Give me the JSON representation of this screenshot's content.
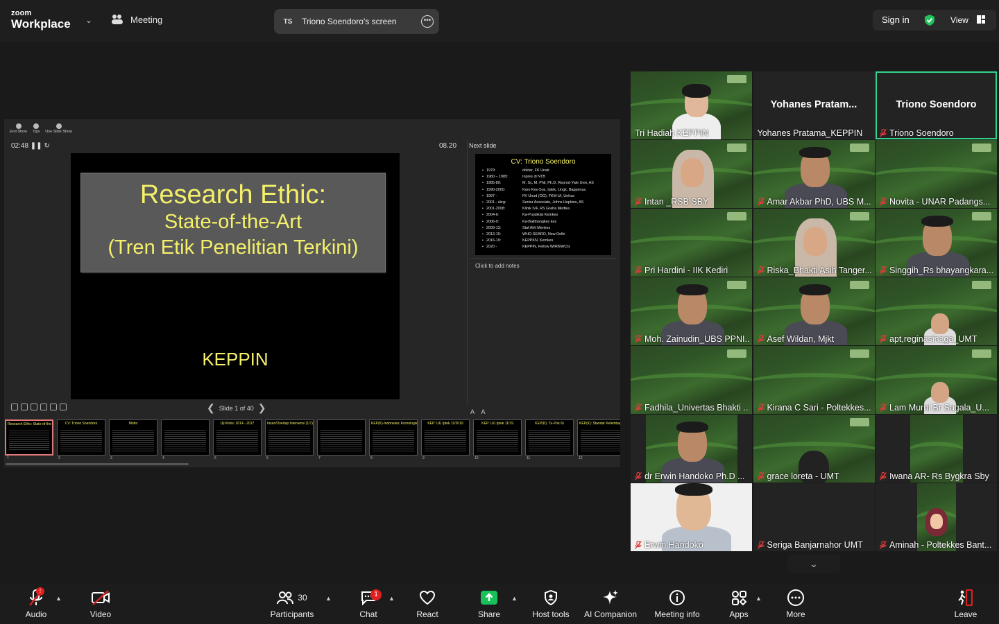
{
  "app": {
    "brand_small": "zoom",
    "brand_big": "Workplace",
    "meeting_label": "Meeting",
    "share_pill": {
      "initials": "TS",
      "label": "Triono Soendoro's screen"
    },
    "sign_in": "Sign in",
    "view": "View",
    "accent": "#32d38b"
  },
  "presenter": {
    "tools": [
      "End Show",
      "Tips",
      "Use Slide Show"
    ],
    "timer": "02:48",
    "clock": "08.20",
    "next_label": "Next slide",
    "notes_placeholder": "Click to add notes",
    "slide_counter": "Slide 1 of 40",
    "current_slide": {
      "title": "Research Ethic:",
      "line2": "State-of-the-Art",
      "line3": "(Tren Etik Penelitian Terkini)",
      "footer": "KEPPIN"
    },
    "next_slide": {
      "title": "CV: Triono Soendoro",
      "rows": [
        {
          "year": "1979:",
          "desc": "dokter, FK Unair"
        },
        {
          "year": "1980 – 1985:",
          "desc": "Inpres di NTB"
        },
        {
          "year": "1985-89:",
          "desc": "M. Sc, M. Phil, Ph.D, Reprod-Yale Univ, AS"
        },
        {
          "year": "1990-2000:",
          "desc": "Karo Kes-Sos, Iptek, Lingk, Bappenas."
        },
        {
          "year": "1997 -",
          "desc": "FK Unud (OG), FKM-UI, Unhas"
        },
        {
          "year": "2001 - skrg:",
          "desc": "Senior Associate, Johns Hopkins, AS"
        },
        {
          "year": "2001-2008:",
          "desc": "Klinik IVF, RS Graha Medika"
        },
        {
          "year": "2004-6:",
          "desc": "Ka-Pusdiklat Kemkes"
        },
        {
          "year": "2006-9:",
          "desc": "Ka-Balitbangkes kes"
        },
        {
          "year": "2009-13:",
          "desc": "Staf Ahli Menkes"
        },
        {
          "year": "2013-15:",
          "desc": "WHO-SEARO, New Delhi"
        },
        {
          "year": "2016-19:",
          "desc": "KEPPKN, Kemkes"
        },
        {
          "year": "2020 -",
          "desc": "KEPPIN, Fellow WIRB/WCG"
        }
      ]
    },
    "thumbnails": [
      {
        "n": "1",
        "title": "Research Ethic: State-of-the-Art (Tren Etik Penelitian Terkini)"
      },
      {
        "n": "2",
        "title": "CV: Triono Soendoro"
      },
      {
        "n": "3",
        "title": "Motto"
      },
      {
        "n": "4",
        "title": ""
      },
      {
        "n": "5",
        "title": "Uji Klinis: 2014 - 2017"
      },
      {
        "n": "6",
        "title": "Irisan/Overlap Intervensi (1/7)"
      },
      {
        "n": "7",
        "title": ""
      },
      {
        "n": "8",
        "title": "KEP(K)-Indonesia: Kronologis"
      },
      {
        "n": "9",
        "title": "KEP: UU Iptek 11/2019"
      },
      {
        "n": "10",
        "title": "KEP: UU Iptek 11/19"
      },
      {
        "n": "11",
        "title": "KEP(K): Tu-Pok-Si"
      },
      {
        "n": "12",
        "title": "KEP(K): Standar Kelembagaan"
      }
    ]
  },
  "gallery": {
    "tiles": [
      {
        "name": "Tri Hadiah KEPPIN",
        "big": "",
        "muted": false,
        "bg": "kep",
        "person": "woman-glasses"
      },
      {
        "name": "Yohanes Pratama_KEPPIN",
        "big": "Yohanes  Pratam...",
        "muted": false,
        "bg": "dark",
        "person": ""
      },
      {
        "name": "Triono Soendoro",
        "big": "Triono Soendoro",
        "muted": true,
        "bg": "dark",
        "person": "",
        "active": true
      },
      {
        "name": "Intan _RSB SBY",
        "big": "",
        "muted": true,
        "bg": "kep",
        "person": "woman-hijab"
      },
      {
        "name": "Amar Akbar PhD, UBS M...",
        "big": "",
        "muted": true,
        "bg": "kep",
        "person": "man"
      },
      {
        "name": "Novita - UNAR Padangs...",
        "big": "",
        "muted": true,
        "bg": "kep",
        "person": ""
      },
      {
        "name": "Pri Hardini - IIK Kediri",
        "big": "",
        "muted": true,
        "bg": "kep",
        "person": ""
      },
      {
        "name": "Riska_Bhakti Asih Tanger...",
        "big": "",
        "muted": true,
        "bg": "kep",
        "person": "woman-hijab"
      },
      {
        "name": "Singgih_Rs bhayangkara...",
        "big": "",
        "muted": true,
        "bg": "kep",
        "person": "man"
      },
      {
        "name": "Moh. Zainudin_UBS PPNI...",
        "big": "",
        "muted": true,
        "bg": "kep",
        "person": "man"
      },
      {
        "name": "Asef Wildan, Mjkt",
        "big": "",
        "muted": true,
        "bg": "kep",
        "person": "man"
      },
      {
        "name": "apt,reginasinaga_UMT",
        "big": "",
        "muted": true,
        "bg": "kep",
        "person": "woman-small"
      },
      {
        "name": "Fadhila_Univertas Bhakti ...",
        "big": "",
        "muted": true,
        "bg": "kep",
        "person": ""
      },
      {
        "name": "Kirana C Sari - Poltekkes...",
        "big": "",
        "muted": true,
        "bg": "kep",
        "person": ""
      },
      {
        "name": "Lam Murni Br Sagala_U...",
        "big": "",
        "muted": true,
        "bg": "kep",
        "person": "woman-small"
      },
      {
        "name": "dr Erwin Handoko Ph.D ...",
        "big": "",
        "muted": true,
        "bg": "kep-narrow",
        "person": "man-glasses"
      },
      {
        "name": "grace loreta - UMT",
        "big": "",
        "muted": true,
        "bg": "kep",
        "person": "dark-person"
      },
      {
        "name": "Iwana AR- Rs Bygkra Sby",
        "big": "",
        "muted": true,
        "bg": "kep-strip",
        "person": ""
      },
      {
        "name": "Erwin Handoko",
        "big": "",
        "muted": true,
        "bg": "white",
        "person": "man-glasses-big"
      },
      {
        "name": "Seriga Banjarnahor UMT",
        "big": "",
        "muted": true,
        "bg": "dark",
        "person": ""
      },
      {
        "name": "Aminah - Poltekkes Bant...",
        "big": "",
        "muted": true,
        "bg": "kep-strip2",
        "person": "hijab-avatar"
      }
    ]
  },
  "toolbar": {
    "audio": "Audio",
    "audio_badge": "!",
    "video": "Video",
    "participants": "Participants",
    "participants_count": "30",
    "chat": "Chat",
    "chat_badge": "1",
    "react": "React",
    "share": "Share",
    "host_tools": "Host tools",
    "ai_companion": "AI Companion",
    "meeting_info": "Meeting info",
    "apps": "Apps",
    "more": "More",
    "leave": "Leave"
  }
}
